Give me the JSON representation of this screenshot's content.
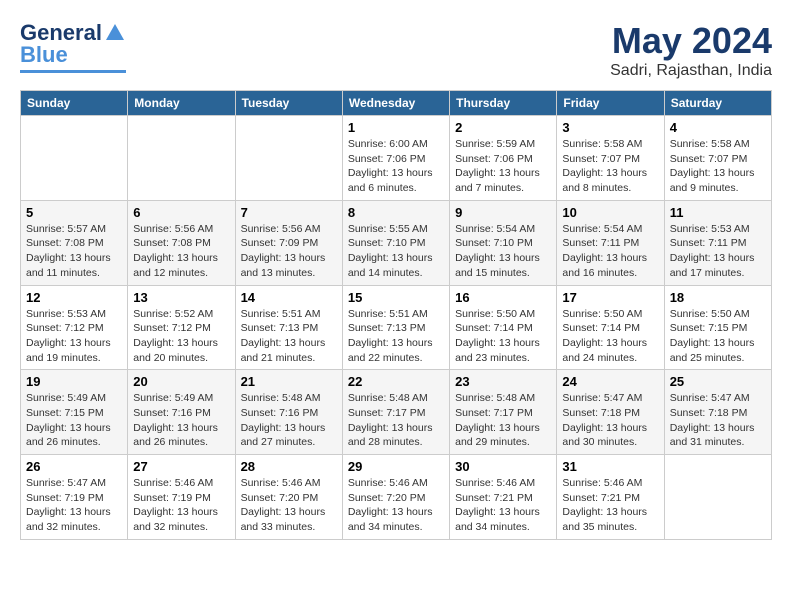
{
  "logo": {
    "line1": "General",
    "line2": "Blue"
  },
  "title": "May 2024",
  "subtitle": "Sadri, Rajasthan, India",
  "days_of_week": [
    "Sunday",
    "Monday",
    "Tuesday",
    "Wednesday",
    "Thursday",
    "Friday",
    "Saturday"
  ],
  "weeks": [
    [
      {
        "day": "",
        "info": ""
      },
      {
        "day": "",
        "info": ""
      },
      {
        "day": "",
        "info": ""
      },
      {
        "day": "1",
        "info": "Sunrise: 6:00 AM\nSunset: 7:06 PM\nDaylight: 13 hours and 6 minutes."
      },
      {
        "day": "2",
        "info": "Sunrise: 5:59 AM\nSunset: 7:06 PM\nDaylight: 13 hours and 7 minutes."
      },
      {
        "day": "3",
        "info": "Sunrise: 5:58 AM\nSunset: 7:07 PM\nDaylight: 13 hours and 8 minutes."
      },
      {
        "day": "4",
        "info": "Sunrise: 5:58 AM\nSunset: 7:07 PM\nDaylight: 13 hours and 9 minutes."
      }
    ],
    [
      {
        "day": "5",
        "info": "Sunrise: 5:57 AM\nSunset: 7:08 PM\nDaylight: 13 hours and 11 minutes."
      },
      {
        "day": "6",
        "info": "Sunrise: 5:56 AM\nSunset: 7:08 PM\nDaylight: 13 hours and 12 minutes."
      },
      {
        "day": "7",
        "info": "Sunrise: 5:56 AM\nSunset: 7:09 PM\nDaylight: 13 hours and 13 minutes."
      },
      {
        "day": "8",
        "info": "Sunrise: 5:55 AM\nSunset: 7:10 PM\nDaylight: 13 hours and 14 minutes."
      },
      {
        "day": "9",
        "info": "Sunrise: 5:54 AM\nSunset: 7:10 PM\nDaylight: 13 hours and 15 minutes."
      },
      {
        "day": "10",
        "info": "Sunrise: 5:54 AM\nSunset: 7:11 PM\nDaylight: 13 hours and 16 minutes."
      },
      {
        "day": "11",
        "info": "Sunrise: 5:53 AM\nSunset: 7:11 PM\nDaylight: 13 hours and 17 minutes."
      }
    ],
    [
      {
        "day": "12",
        "info": "Sunrise: 5:53 AM\nSunset: 7:12 PM\nDaylight: 13 hours and 19 minutes."
      },
      {
        "day": "13",
        "info": "Sunrise: 5:52 AM\nSunset: 7:12 PM\nDaylight: 13 hours and 20 minutes."
      },
      {
        "day": "14",
        "info": "Sunrise: 5:51 AM\nSunset: 7:13 PM\nDaylight: 13 hours and 21 minutes."
      },
      {
        "day": "15",
        "info": "Sunrise: 5:51 AM\nSunset: 7:13 PM\nDaylight: 13 hours and 22 minutes."
      },
      {
        "day": "16",
        "info": "Sunrise: 5:50 AM\nSunset: 7:14 PM\nDaylight: 13 hours and 23 minutes."
      },
      {
        "day": "17",
        "info": "Sunrise: 5:50 AM\nSunset: 7:14 PM\nDaylight: 13 hours and 24 minutes."
      },
      {
        "day": "18",
        "info": "Sunrise: 5:50 AM\nSunset: 7:15 PM\nDaylight: 13 hours and 25 minutes."
      }
    ],
    [
      {
        "day": "19",
        "info": "Sunrise: 5:49 AM\nSunset: 7:15 PM\nDaylight: 13 hours and 26 minutes."
      },
      {
        "day": "20",
        "info": "Sunrise: 5:49 AM\nSunset: 7:16 PM\nDaylight: 13 hours and 26 minutes."
      },
      {
        "day": "21",
        "info": "Sunrise: 5:48 AM\nSunset: 7:16 PM\nDaylight: 13 hours and 27 minutes."
      },
      {
        "day": "22",
        "info": "Sunrise: 5:48 AM\nSunset: 7:17 PM\nDaylight: 13 hours and 28 minutes."
      },
      {
        "day": "23",
        "info": "Sunrise: 5:48 AM\nSunset: 7:17 PM\nDaylight: 13 hours and 29 minutes."
      },
      {
        "day": "24",
        "info": "Sunrise: 5:47 AM\nSunset: 7:18 PM\nDaylight: 13 hours and 30 minutes."
      },
      {
        "day": "25",
        "info": "Sunrise: 5:47 AM\nSunset: 7:18 PM\nDaylight: 13 hours and 31 minutes."
      }
    ],
    [
      {
        "day": "26",
        "info": "Sunrise: 5:47 AM\nSunset: 7:19 PM\nDaylight: 13 hours and 32 minutes."
      },
      {
        "day": "27",
        "info": "Sunrise: 5:46 AM\nSunset: 7:19 PM\nDaylight: 13 hours and 32 minutes."
      },
      {
        "day": "28",
        "info": "Sunrise: 5:46 AM\nSunset: 7:20 PM\nDaylight: 13 hours and 33 minutes."
      },
      {
        "day": "29",
        "info": "Sunrise: 5:46 AM\nSunset: 7:20 PM\nDaylight: 13 hours and 34 minutes."
      },
      {
        "day": "30",
        "info": "Sunrise: 5:46 AM\nSunset: 7:21 PM\nDaylight: 13 hours and 34 minutes."
      },
      {
        "day": "31",
        "info": "Sunrise: 5:46 AM\nSunset: 7:21 PM\nDaylight: 13 hours and 35 minutes."
      },
      {
        "day": "",
        "info": ""
      }
    ]
  ]
}
